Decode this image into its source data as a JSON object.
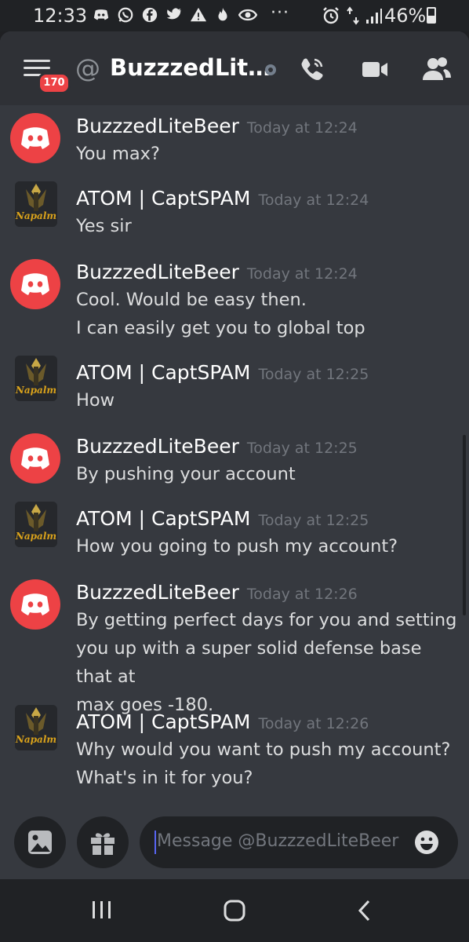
{
  "status_bar": {
    "time": "12:33",
    "more": "···",
    "battery_percent": "46%",
    "notification_icons": [
      "discord-icon",
      "whatsapp-icon",
      "facebook-icon",
      "twitter-icon",
      "warning-icon",
      "fire-icon",
      "eye-icon"
    ]
  },
  "header": {
    "unread_badge": "170",
    "at_symbol": "@",
    "channel_title": "BuzzzedLit…"
  },
  "messages": [
    {
      "author": "BuzzzedLiteBeer",
      "timestamp": "Today at 12:24",
      "lines": [
        "You max?"
      ],
      "avatar": "discord"
    },
    {
      "author": "ATOM | CaptSPAM",
      "timestamp": "Today at 12:24",
      "lines": [
        "Yes sir"
      ],
      "avatar": "napalm"
    },
    {
      "author": "BuzzzedLiteBeer",
      "timestamp": "Today at 12:24",
      "lines": [
        "Cool. Would be easy then.",
        "I can easily get you to global top"
      ],
      "avatar": "discord"
    },
    {
      "author": "ATOM | CaptSPAM",
      "timestamp": "Today at 12:25",
      "lines": [
        "How"
      ],
      "avatar": "napalm"
    },
    {
      "author": "BuzzzedLiteBeer",
      "timestamp": "Today at 12:25",
      "lines": [
        "By pushing your account"
      ],
      "avatar": "discord"
    },
    {
      "author": "ATOM | CaptSPAM",
      "timestamp": "Today at 12:25",
      "lines": [
        "How you going to push my account?"
      ],
      "avatar": "napalm"
    },
    {
      "author": "BuzzzedLiteBeer",
      "timestamp": "Today at 12:26",
      "lines": [
        "By getting perfect days for you and setting",
        "you up with a super solid defense base that at",
        "max goes -180."
      ],
      "avatar": "discord"
    },
    {
      "author": "ATOM | CaptSPAM",
      "timestamp": "Today at 12:26",
      "lines": [
        "Why would you want to push my account?",
        "What's in it for you?"
      ],
      "avatar": "napalm"
    }
  ],
  "composer": {
    "placeholder": "Message @BuzzzedLiteBeer"
  },
  "avatar_text": "Napalm",
  "colors": {
    "accent": "#5865f2",
    "discord_red": "#ed4245",
    "background": "#36393f"
  }
}
